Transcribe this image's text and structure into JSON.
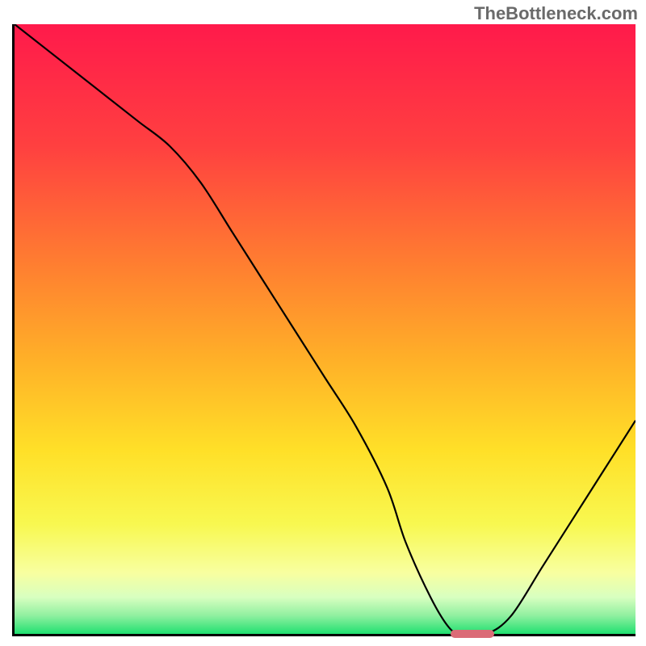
{
  "watermark": "TheBottleneck.com",
  "chart_data": {
    "type": "line",
    "title": "",
    "xlabel": "",
    "ylabel": "",
    "xlim": [
      0,
      100
    ],
    "ylim": [
      0,
      100
    ],
    "x": [
      0,
      5,
      10,
      15,
      20,
      25,
      30,
      35,
      40,
      45,
      50,
      55,
      60,
      63,
      67,
      70,
      72,
      76,
      80,
      85,
      90,
      95,
      100
    ],
    "y": [
      100,
      96,
      92,
      88,
      84,
      80,
      74,
      66,
      58,
      50,
      42,
      34,
      24,
      15,
      6,
      1,
      0,
      0,
      3,
      11,
      19,
      27,
      35
    ],
    "marker": {
      "x_start": 70,
      "x_end": 77,
      "y": 0
    },
    "gradient_stops": [
      {
        "offset": 0,
        "color": "#ff1a4b"
      },
      {
        "offset": 20,
        "color": "#ff4040"
      },
      {
        "offset": 40,
        "color": "#ff8030"
      },
      {
        "offset": 55,
        "color": "#ffb028"
      },
      {
        "offset": 70,
        "color": "#ffe028"
      },
      {
        "offset": 82,
        "color": "#f8f850"
      },
      {
        "offset": 90,
        "color": "#f8ffa0"
      },
      {
        "offset": 94,
        "color": "#d8ffc0"
      },
      {
        "offset": 97,
        "color": "#90f0a0"
      },
      {
        "offset": 100,
        "color": "#20e070"
      }
    ]
  }
}
